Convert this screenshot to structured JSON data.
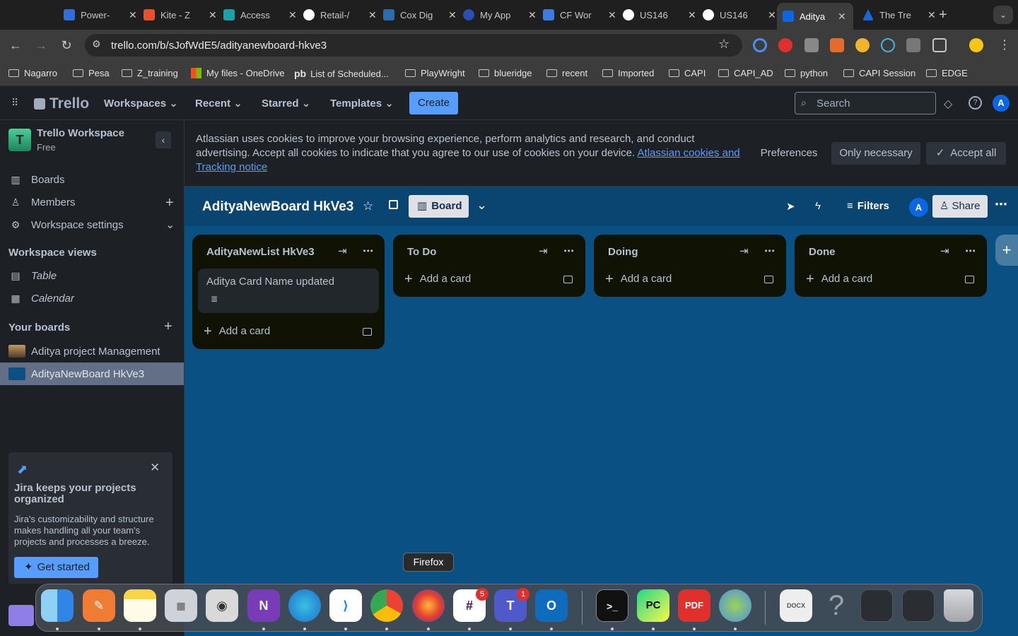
{
  "browser": {
    "tabs": [
      {
        "title": "Power-",
        "color": "#2f6fd6"
      },
      {
        "title": "Kite - Z",
        "color": "#e8502f"
      },
      {
        "title": "Access",
        "color": "#1ca0a6"
      },
      {
        "title": "Retail-/",
        "color": "#ffffff"
      },
      {
        "title": "Cox Dig",
        "color": "#2b6cb0"
      },
      {
        "title": "My App",
        "color": "#2b4fb0"
      },
      {
        "title": "CF Wor",
        "color": "#3c7be0"
      },
      {
        "title": "US146",
        "color": "#ffffff"
      },
      {
        "title": "US146",
        "color": "#ffffff"
      },
      {
        "title": "Aditya",
        "color": "#0c66e4"
      },
      {
        "title": "The Tre",
        "color": "#1868db"
      }
    ],
    "url": "trello.com/b/sJofWdE5/adityanewboard-hkve3",
    "bookmarks": [
      "Nagarro",
      "Pesa",
      "Z_training",
      "My files - OneDrive",
      "List of Scheduled...",
      "PlayWright",
      "blueridge",
      "recent",
      "Imported",
      "CAPI",
      "CAPI_AD",
      "python",
      "CAPI Session",
      "EDGE"
    ]
  },
  "header": {
    "logo": "Trello",
    "nav": [
      "Workspaces",
      "Recent",
      "Starred",
      "Templates"
    ],
    "create": "Create",
    "search_placeholder": "Search",
    "avatar": "A"
  },
  "sidebar": {
    "workspace_initial": "T",
    "workspace_name": "Trello Workspace",
    "workspace_plan": "Free",
    "items": [
      "Boards",
      "Members",
      "Workspace settings"
    ],
    "views_heading": "Workspace views",
    "views": [
      "Table",
      "Calendar"
    ],
    "boards_heading": "Your boards",
    "boards": [
      "Aditya project Management",
      "AdityaNewBoard HkVe3"
    ]
  },
  "cookie": {
    "text": "Atlassian uses cookies to improve your browsing experience, perform analytics and research, and conduct advertising. Accept all cookies to indicate that you agree to our use of cookies on your device.",
    "link": "Atlassian cookies and Tracking notice",
    "preferences": "Preferences",
    "only_necessary": "Only necessary",
    "accept_all": "Accept all"
  },
  "board": {
    "title": "AdityaNewBoard HkVe3",
    "view": "Board",
    "filters": "Filters",
    "share": "Share",
    "avatar": "A",
    "lists": [
      {
        "title": "AdityaNewList HkVe3",
        "cards": [
          "Aditya Card Name updated"
        ],
        "add": "Add a card"
      },
      {
        "title": "To Do",
        "cards": [],
        "add": "Add a card"
      },
      {
        "title": "Doing",
        "cards": [],
        "add": "Add a card"
      },
      {
        "title": "Done",
        "cards": [],
        "add": "Add a card"
      }
    ]
  },
  "promo": {
    "title": "Jira keeps your projects organized",
    "body": "Jira's customizability and structure makes handling all your team's projects and processes a breeze.",
    "cta": "Get started"
  },
  "dock": {
    "tooltip": "Firefox",
    "slack_badge": "5",
    "teams_badge": "1",
    "apps": [
      "finder",
      "pages",
      "notes",
      "launchpad",
      "screenshot",
      "onenote",
      "edge",
      "vscode",
      "chrome",
      "firefox",
      "slack",
      "teams",
      "outlook",
      "terminal",
      "pycharm",
      "pdf",
      "network",
      "document",
      "help",
      "window-1",
      "window-2",
      "trash"
    ]
  }
}
